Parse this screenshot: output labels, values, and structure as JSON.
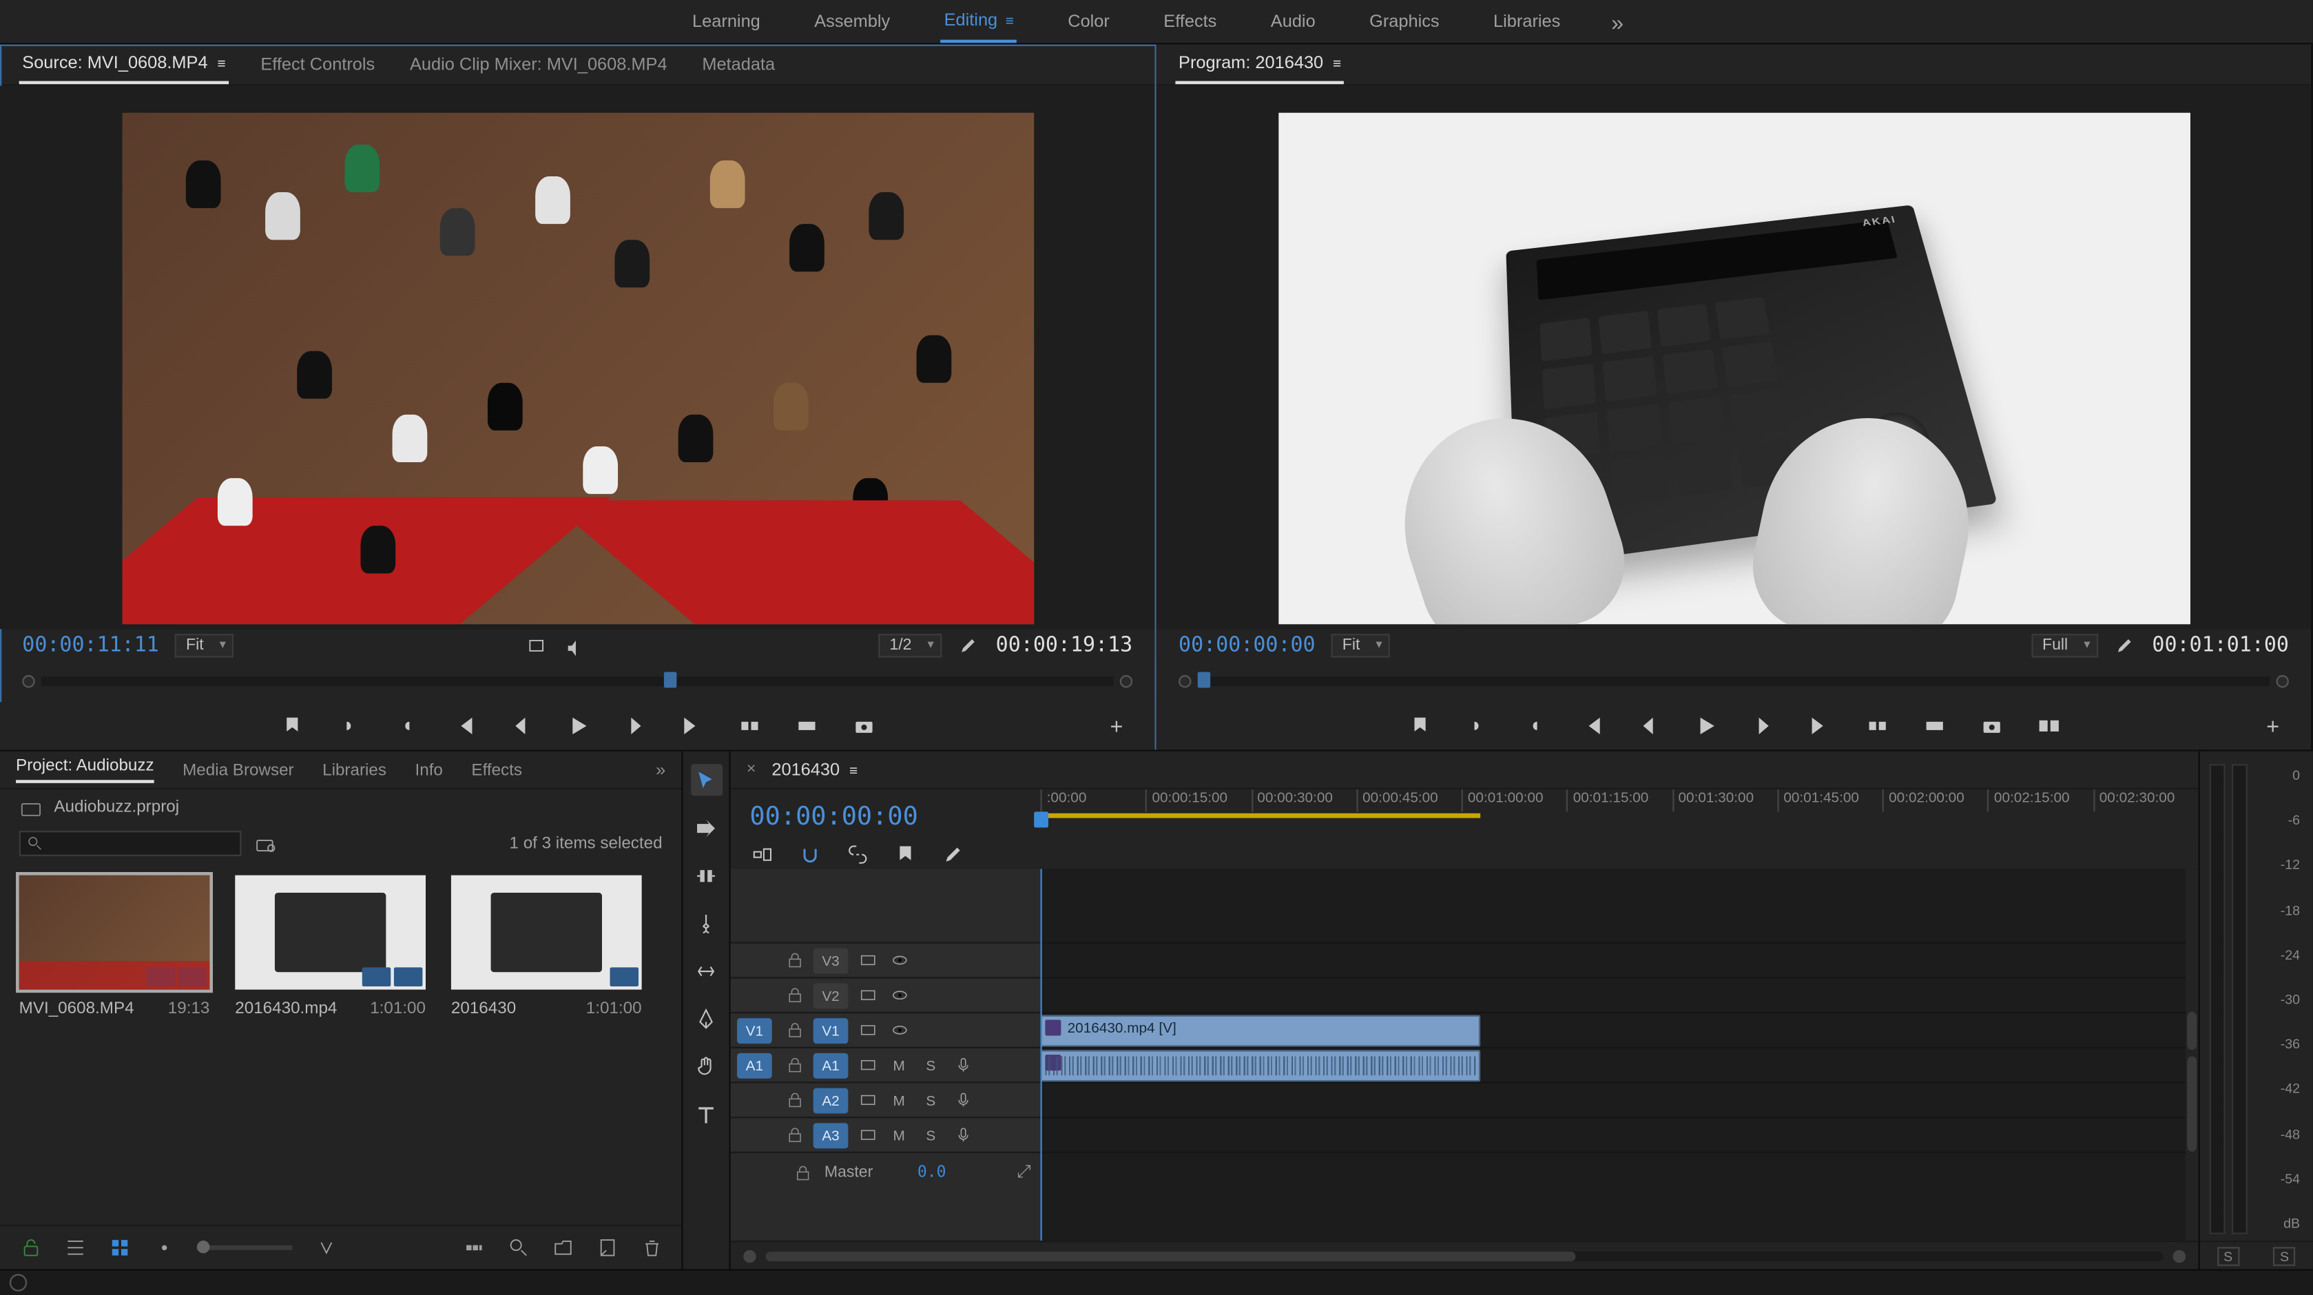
{
  "workspaces": [
    "Learning",
    "Assembly",
    "Editing",
    "Color",
    "Effects",
    "Audio",
    "Graphics",
    "Libraries"
  ],
  "workspace_active": "Editing",
  "source_panel": {
    "tabs": [
      "Source: MVI_0608.MP4",
      "Effect Controls",
      "Audio Clip Mixer: MVI_0608.MP4",
      "Metadata"
    ],
    "active_tab": 0,
    "current_tc": "00:00:11:11",
    "duration_tc": "00:00:19:13",
    "zoom": "Fit",
    "ratio": "1/2"
  },
  "program_panel": {
    "title": "Program: 2016430",
    "current_tc": "00:00:00:00",
    "duration_tc": "00:01:01:00",
    "zoom": "Fit",
    "quality": "Full"
  },
  "project_panel": {
    "tabs": [
      "Project: Audiobuzz",
      "Media Browser",
      "Libraries",
      "Info",
      "Effects"
    ],
    "project_file": "Audiobuzz.prproj",
    "selection_text": "1 of 3 items selected",
    "items": [
      {
        "name": "MVI_0608.MP4",
        "duration": "19:13",
        "thumb": "src",
        "selected": true,
        "badge": "av"
      },
      {
        "name": "2016430.mp4",
        "duration": "1:01:00",
        "thumb": "prog",
        "selected": false,
        "badge": "av"
      },
      {
        "name": "2016430",
        "duration": "1:01:00",
        "thumb": "prog",
        "selected": false,
        "badge": "seq"
      }
    ]
  },
  "timeline": {
    "sequence_name": "2016430",
    "current_tc": "00:00:00:00",
    "ruler_ticks": [
      ":00:00",
      "00:00:15:00",
      "00:00:30:00",
      "00:00:45:00",
      "00:01:00:00",
      "00:01:15:00",
      "00:01:30:00",
      "00:01:45:00",
      "00:02:00:00",
      "00:02:15:00",
      "00:02:30:00"
    ],
    "work_area_pct": 38,
    "playhead_pct": 0,
    "tracks_video": [
      {
        "src": "",
        "target": "V3",
        "target_on": false
      },
      {
        "src": "",
        "target": "V2",
        "target_on": false
      },
      {
        "src": "V1",
        "target": "V1",
        "target_on": true
      }
    ],
    "tracks_audio": [
      {
        "src": "A1",
        "target": "A1",
        "target_on": true
      },
      {
        "src": "",
        "target": "A2",
        "target_on": true
      },
      {
        "src": "",
        "target": "A3",
        "target_on": true
      }
    ],
    "master_label": "Master",
    "master_value": "0.0",
    "clip_video": {
      "name": "2016430.mp4 [V]",
      "start_pct": 0,
      "len_pct": 38
    },
    "clip_audio": {
      "start_pct": 0,
      "len_pct": 38
    }
  },
  "meters": {
    "scale": [
      "0",
      "-6",
      "-12",
      "-18",
      "-24",
      "-30",
      "-36",
      "-42",
      "-48",
      "-54",
      "dB"
    ],
    "solo_labels": [
      "S",
      "S"
    ]
  },
  "transport_tooltips": {
    "mark_in": "Mark In",
    "mark_out": "Mark Out",
    "go_in": "Go to In",
    "step_back": "Step Back",
    "play": "Play",
    "step_fwd": "Step Forward",
    "go_out": "Go to Out",
    "insert": "Insert",
    "overwrite": "Overwrite",
    "export_frame": "Export Frame"
  },
  "akai_brand": "AKAI"
}
